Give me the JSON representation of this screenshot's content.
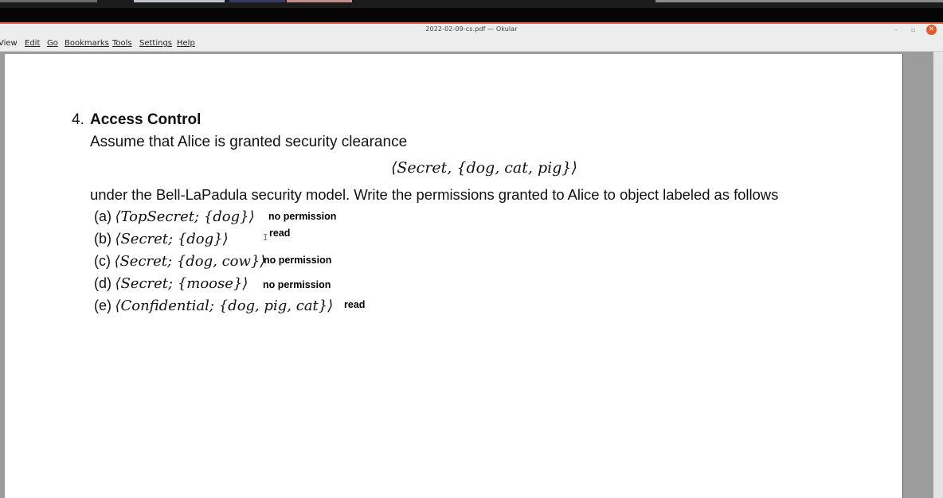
{
  "window": {
    "title": "2022-02-09-cs.pdf — Okular",
    "controls": {
      "minimize": "–",
      "maximize": "▫",
      "close": "✕"
    }
  },
  "menubar": {
    "items": [
      {
        "label": "View",
        "mnemonic_index": 0
      },
      {
        "label": "Edit",
        "mnemonic_index": 0
      },
      {
        "label": "Go",
        "mnemonic_index": 0
      },
      {
        "label": "Bookmarks",
        "mnemonic_index": 0
      },
      {
        "label": "Tools",
        "mnemonic_index": 0
      },
      {
        "label": "Settings",
        "mnemonic_index": 0
      },
      {
        "label": "Help",
        "mnemonic_index": 0
      }
    ]
  },
  "document": {
    "question_number": "4.",
    "question_title": "Access Control",
    "assume_text": "Assume that Alice is granted security clearance",
    "clearance": "⟨Secret, {dog, cat, pig}⟩",
    "under_text": "under the Bell-LaPadula security model. Write the permissions granted to Alice to object labeled as follows",
    "options": [
      {
        "label": "(a)",
        "math": "⟨TopSecret; {dog}⟩",
        "answer": "no permission"
      },
      {
        "label": "(b)",
        "math": "⟨Secret; {dog}⟩",
        "answer": "read"
      },
      {
        "label": "(c)",
        "math": "⟨Secret; {dog, cow}⟩",
        "answer": "no permission"
      },
      {
        "label": "(d)",
        "math": "⟨Secret; {moose}⟩",
        "answer": "no permission"
      },
      {
        "label": "(e)",
        "math": "⟨Confidential; {dog, pig, cat}⟩",
        "answer": "read"
      }
    ],
    "text_cursor": "I"
  },
  "colors": {
    "titlebar_accent": "#e4613a",
    "close_button": "#e8582a",
    "viewer_background": "#9c9c9c"
  }
}
